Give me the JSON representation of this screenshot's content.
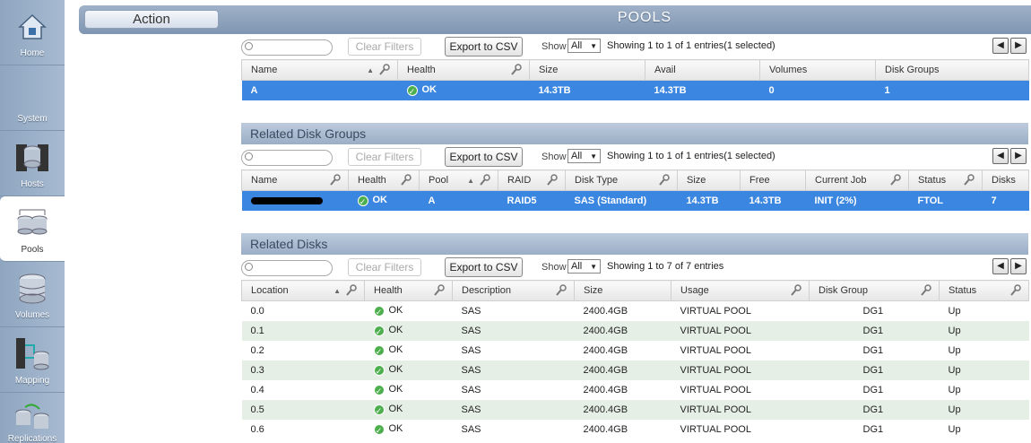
{
  "nav": [
    {
      "label": "Home",
      "icon": "home-icon",
      "active": false
    },
    {
      "label": "System",
      "icon": "system-icon",
      "active": false
    },
    {
      "label": "Hosts",
      "icon": "hosts-icon",
      "active": false
    },
    {
      "label": "Pools",
      "icon": "pools-icon",
      "active": true
    },
    {
      "label": "Volumes",
      "icon": "volumes-icon",
      "active": false
    },
    {
      "label": "Mapping",
      "icon": "mapping-icon",
      "active": false
    },
    {
      "label": "Replications",
      "icon": "replications-icon",
      "active": false
    }
  ],
  "topbar": {
    "action_label": "Action",
    "title": "POOLS"
  },
  "common": {
    "clear_filters": "Clear Filters",
    "export_csv": "Export to CSV",
    "show_label": "Show",
    "show_value": "All"
  },
  "pools": {
    "entries": "Showing 1 to 1 of 1 entries(1 selected)",
    "columns": [
      "Name",
      "Health",
      "Size",
      "Avail",
      "Volumes",
      "Disk Groups"
    ],
    "rows": [
      {
        "name": "A",
        "health": "OK",
        "size": "14.3TB",
        "avail": "14.3TB",
        "volumes": "0",
        "disk_groups": "1"
      }
    ]
  },
  "disk_groups": {
    "header": "Related Disk Groups",
    "entries": "Showing 1 to 1 of 1 entries(1 selected)",
    "columns": [
      "Name",
      "Health",
      "Pool",
      "RAID",
      "Disk Type",
      "Size",
      "Free",
      "Current Job",
      "Status",
      "Disks"
    ],
    "rows": [
      {
        "name": "",
        "health": "OK",
        "pool": "A",
        "raid": "RAID5",
        "disk_type": "SAS (Standard)",
        "size": "14.3TB",
        "free": "14.3TB",
        "current_job": "INIT (2%)",
        "status": "FTOL",
        "disks": "7"
      }
    ]
  },
  "disks": {
    "header": "Related Disks",
    "entries": "Showing 1 to 7 of 7 entries",
    "columns": [
      "Location",
      "Health",
      "Description",
      "Size",
      "Usage",
      "Disk Group",
      "Status"
    ],
    "rows": [
      {
        "location": "0.0",
        "health": "OK",
        "description": "SAS",
        "size": "2400.4GB",
        "usage": "VIRTUAL POOL",
        "disk_group": "DG1",
        "status": "Up"
      },
      {
        "location": "0.1",
        "health": "OK",
        "description": "SAS",
        "size": "2400.4GB",
        "usage": "VIRTUAL POOL",
        "disk_group": "DG1",
        "status": "Up"
      },
      {
        "location": "0.2",
        "health": "OK",
        "description": "SAS",
        "size": "2400.4GB",
        "usage": "VIRTUAL POOL",
        "disk_group": "DG1",
        "status": "Up"
      },
      {
        "location": "0.3",
        "health": "OK",
        "description": "SAS",
        "size": "2400.4GB",
        "usage": "VIRTUAL POOL",
        "disk_group": "DG1",
        "status": "Up"
      },
      {
        "location": "0.4",
        "health": "OK",
        "description": "SAS",
        "size": "2400.4GB",
        "usage": "VIRTUAL POOL",
        "disk_group": "DG1",
        "status": "Up"
      },
      {
        "location": "0.5",
        "health": "OK",
        "description": "SAS",
        "size": "2400.4GB",
        "usage": "VIRTUAL POOL",
        "disk_group": "DG1",
        "status": "Up"
      },
      {
        "location": "0.6",
        "health": "OK",
        "description": "SAS",
        "size": "2400.4GB",
        "usage": "VIRTUAL POOL",
        "disk_group": "DG1",
        "status": "Up"
      }
    ]
  },
  "colors": {
    "selected_row": "#3a86e0",
    "ok": "#4cae4c",
    "alt_row": "#e6efe6"
  }
}
